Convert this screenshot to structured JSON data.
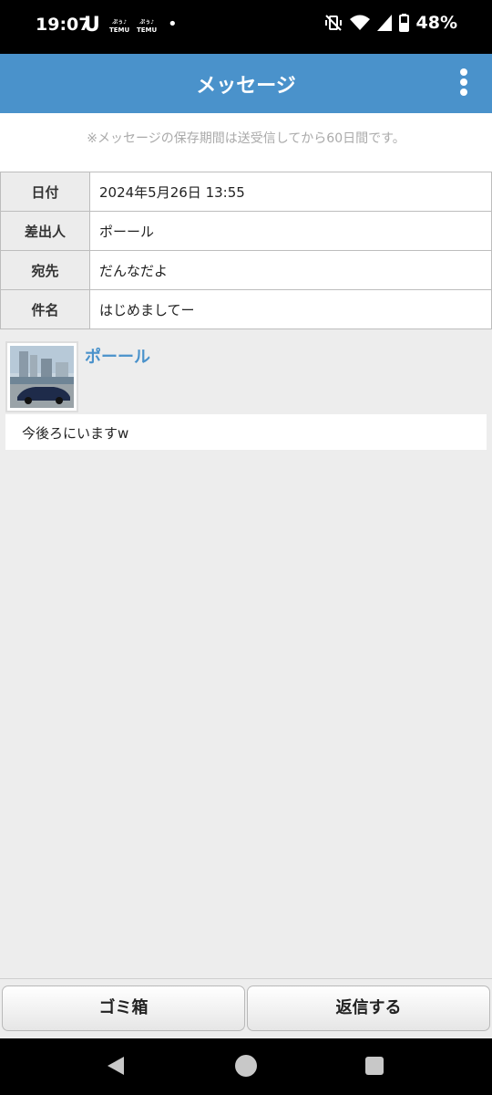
{
  "status_bar": {
    "time": "19:07",
    "app_icon_1": "U",
    "temu_label_1": "TEMU",
    "temu_label_2": "TEMU",
    "battery": "48%"
  },
  "header": {
    "title": "メッセージ",
    "menu_icon": "more-vertical-icon",
    "background_color": "#4a92cb"
  },
  "notice": {
    "retention_text": "※メッセージの保存期間は送受信してから60日間です。"
  },
  "message_meta": [
    {
      "label": "日付",
      "value": "2024年5月26日 13:55"
    },
    {
      "label": "差出人",
      "value": "ポーール"
    },
    {
      "label": "宛先",
      "value": "だんなだよ"
    },
    {
      "label": "件名",
      "value": "はじめましてー"
    }
  ],
  "sender": {
    "name": "ポーール",
    "avatar": "car-photo-thumbnail"
  },
  "message": {
    "body": "今後ろにいますw"
  },
  "actions": {
    "trash_label": "ゴミ箱",
    "reply_label": "返信する"
  },
  "nav": {
    "back_icon": "back-triangle-icon",
    "home_icon": "home-circle-icon",
    "recents_icon": "recents-square-icon"
  }
}
